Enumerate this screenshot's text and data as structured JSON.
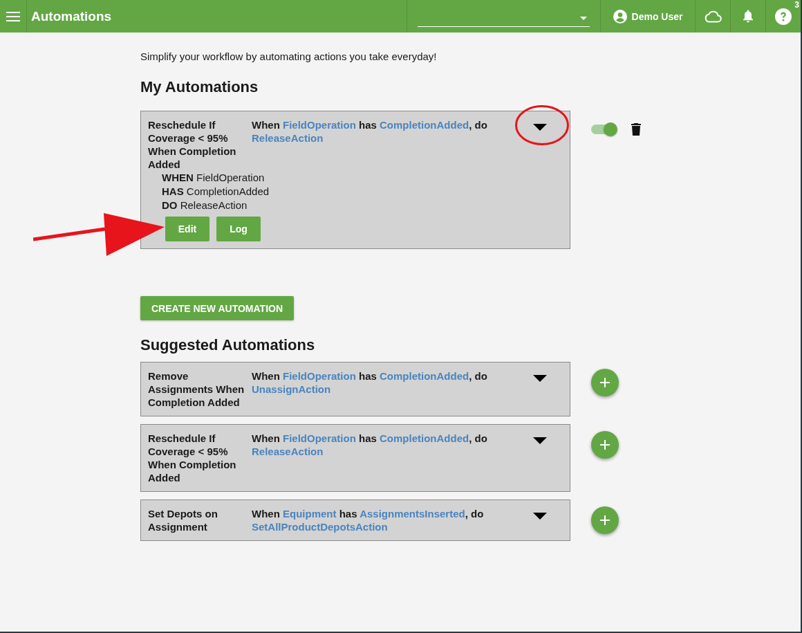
{
  "header": {
    "title": "Automations",
    "user": "Demo User",
    "badge": "3"
  },
  "intro": "Simplify your workflow by automating actions you take everyday!",
  "my_automations": {
    "title": "My Automations",
    "items": [
      {
        "name": "Reschedule If Coverage < 95% When Completion Added",
        "sentence": [
          {
            "kind": "plain",
            "text": "When "
          },
          {
            "kind": "link",
            "text": "FieldOperation"
          },
          {
            "kind": "plain",
            "text": " has "
          },
          {
            "kind": "link",
            "text": "CompletionAdded"
          },
          {
            "kind": "plain",
            "text": ", do "
          },
          {
            "kind": "link",
            "text": "ReleaseAction"
          }
        ],
        "expanded": true,
        "enabled": true,
        "details": [
          {
            "keyword": "WHEN",
            "value": "FieldOperation"
          },
          {
            "keyword": "HAS",
            "value": "CompletionAdded"
          },
          {
            "keyword": "DO",
            "value": "ReleaseAction"
          }
        ],
        "buttons": [
          "Edit",
          "Log"
        ]
      }
    ],
    "create_button": "CREATE NEW AUTOMATION"
  },
  "annotations": {
    "circle_around_caret": true,
    "arrow_to_edit": true
  },
  "suggested": {
    "title": "Suggested Automations",
    "items": [
      {
        "name": "Remove Assignments When Completion Added",
        "sentence": [
          {
            "kind": "plain",
            "text": "When "
          },
          {
            "kind": "link",
            "text": "FieldOperation"
          },
          {
            "kind": "plain",
            "text": " has "
          },
          {
            "kind": "link",
            "text": "CompletionAdded"
          },
          {
            "kind": "plain",
            "text": ", do "
          },
          {
            "kind": "link",
            "text": "UnassignAction"
          }
        ],
        "expanded": false
      },
      {
        "name": "Reschedule If Coverage < 95% When Completion Added",
        "sentence": [
          {
            "kind": "plain",
            "text": "When "
          },
          {
            "kind": "link",
            "text": "FieldOperation"
          },
          {
            "kind": "plain",
            "text": " has "
          },
          {
            "kind": "link",
            "text": "CompletionAdded"
          },
          {
            "kind": "plain",
            "text": ", do "
          },
          {
            "kind": "link",
            "text": "ReleaseAction"
          }
        ],
        "expanded": false
      },
      {
        "name": "Set Depots on Assignment",
        "sentence": [
          {
            "kind": "plain",
            "text": "When "
          },
          {
            "kind": "link",
            "text": "Equipment"
          },
          {
            "kind": "plain",
            "text": " has "
          },
          {
            "kind": "link",
            "text": "AssignmentsInserted"
          },
          {
            "kind": "plain",
            "text": ", do "
          },
          {
            "kind": "link",
            "text": "SetAllProductDepotsAction"
          }
        ],
        "expanded": false
      }
    ]
  }
}
